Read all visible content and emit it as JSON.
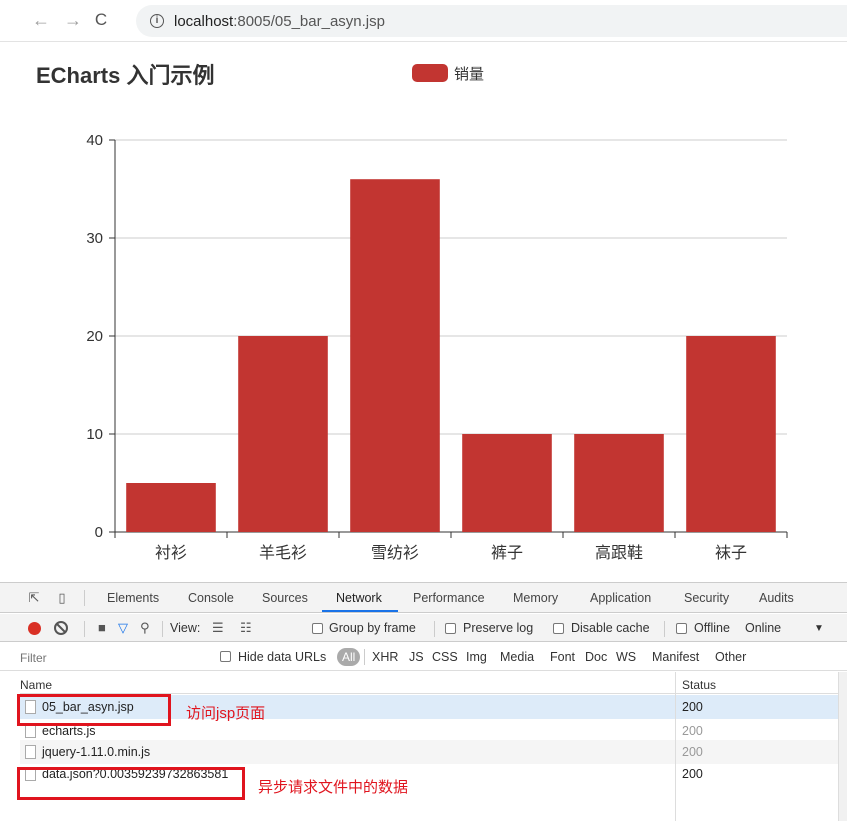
{
  "browser": {
    "back_icon": "←",
    "forward_icon": "→",
    "reload_icon": "C",
    "info_icon": "i",
    "url_host": "localhost",
    "url_rest": ":8005/05_bar_asyn.jsp"
  },
  "chart_data": {
    "type": "bar",
    "title": "ECharts 入门示例",
    "categories": [
      "衬衫",
      "羊毛衫",
      "雪纺衫",
      "裤子",
      "高跟鞋",
      "袜子"
    ],
    "series": [
      {
        "name": "销量",
        "values": [
          5,
          20,
          36,
          10,
          10,
          20
        ]
      }
    ],
    "ylim": [
      0,
      40
    ],
    "yticks": [
      "0",
      "10",
      "20",
      "30",
      "40"
    ],
    "xlabel": "",
    "ylabel": "",
    "grid": true,
    "legend_position": "top-center",
    "bar_color": "#c23531"
  },
  "devtools": {
    "tabs": [
      "Elements",
      "Console",
      "Sources",
      "Network",
      "Performance",
      "Memory",
      "Application",
      "Security",
      "Audits"
    ],
    "active_tab": "Network",
    "toolbar": {
      "view_label": "View:",
      "group_by_frame": "Group by frame",
      "preserve_log": "Preserve log",
      "disable_cache": "Disable cache",
      "offline": "Offline",
      "throttle_value": "Online",
      "dropdown_icon": "▼"
    },
    "filter": {
      "placeholder": "Filter",
      "hide_data_urls": "Hide data URLs",
      "all_label": "All",
      "types": [
        "XHR",
        "JS",
        "CSS",
        "Img",
        "Media",
        "Font",
        "Doc",
        "WS",
        "Manifest",
        "Other"
      ]
    },
    "table": {
      "col_name": "Name",
      "col_status": "Status",
      "rows": [
        {
          "name": "05_bar_asyn.jsp",
          "status": "200"
        },
        {
          "name": "echarts.js",
          "status": "200"
        },
        {
          "name": "jquery-1.11.0.min.js",
          "status": "200"
        },
        {
          "name": "data.json?0.00359239732863581",
          "status": "200"
        }
      ]
    },
    "annotations": {
      "first": "访问jsp页面",
      "second": "异步请求文件中的数据"
    }
  }
}
